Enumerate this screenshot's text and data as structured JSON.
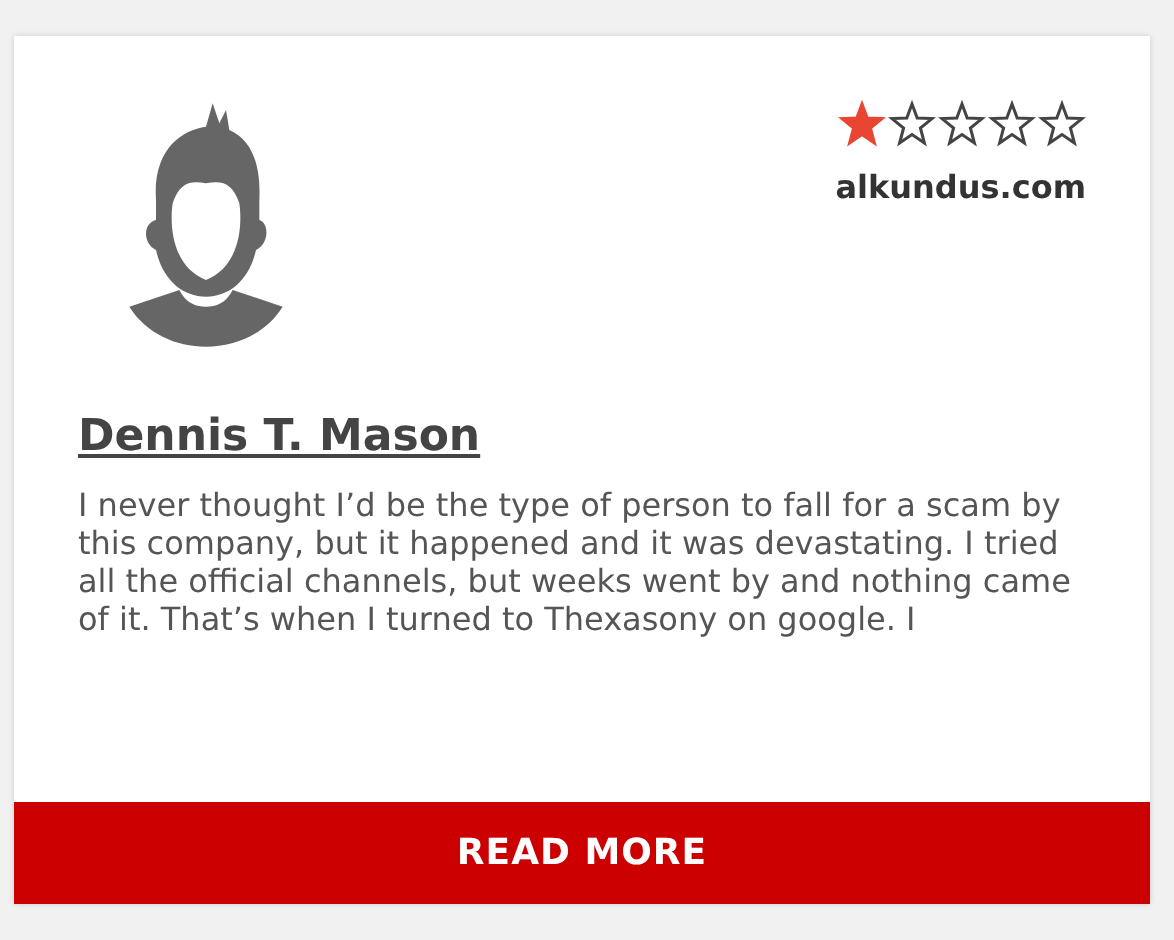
{
  "review": {
    "stars": 1,
    "source": "alkundus.com",
    "author": "Dennis T. Mason",
    "text": "I never thought I’d be the type of person to fall for a scam by this company, but it happened and it was devastating. I tried all the official channels, but weeks went by and nothing came of it. That’s when I turned to Thexasony on google. I"
  },
  "button": "READ MORE"
}
